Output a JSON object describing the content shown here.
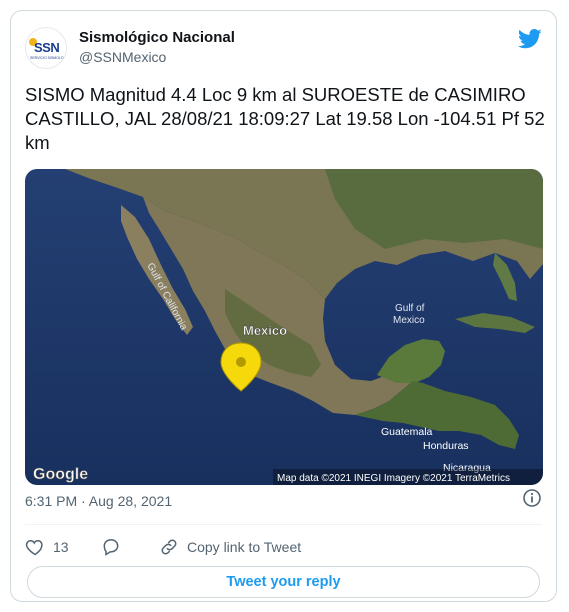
{
  "author": {
    "display_name": "Sismológico Nacional",
    "handle": "@SSNMexico",
    "avatar_text": "SSN",
    "avatar_subtext": "SERVICIO SISMOLÓGICO NACIONAL"
  },
  "tweet": {
    "text": "SISMO Magnitud 4.4 Loc  9 km al SUROESTE de CASIMIRO CASTILLO, JAL 28/08/21 18:09:27 Lat 19.58 Lon -104.51 Pf 52 km"
  },
  "map": {
    "labels": {
      "gulf_of_california": "Gulf of California",
      "mexico": "Mexico",
      "gulf_of_mexico_line1": "Gulf of",
      "gulf_of_mexico_line2": "Mexico",
      "guatemala": "Guatemala",
      "honduras": "Honduras",
      "nicaragua": "Nicaragua"
    },
    "google_logo": "Google",
    "attribution": "Map data ©2021 INEGI Imagery ©2021 TerraMetrics"
  },
  "meta": {
    "timestamp": "6:31 PM · Aug 28, 2021"
  },
  "actions": {
    "like_count": "13",
    "copy_link_label": "Copy link to Tweet"
  },
  "reply_button_label": "Tweet your reply",
  "colors": {
    "twitter_blue": "#1d9bf0",
    "marker_yellow": "#f5d90a",
    "ocean": "#1d3b73",
    "land": "#6e6a4e"
  }
}
